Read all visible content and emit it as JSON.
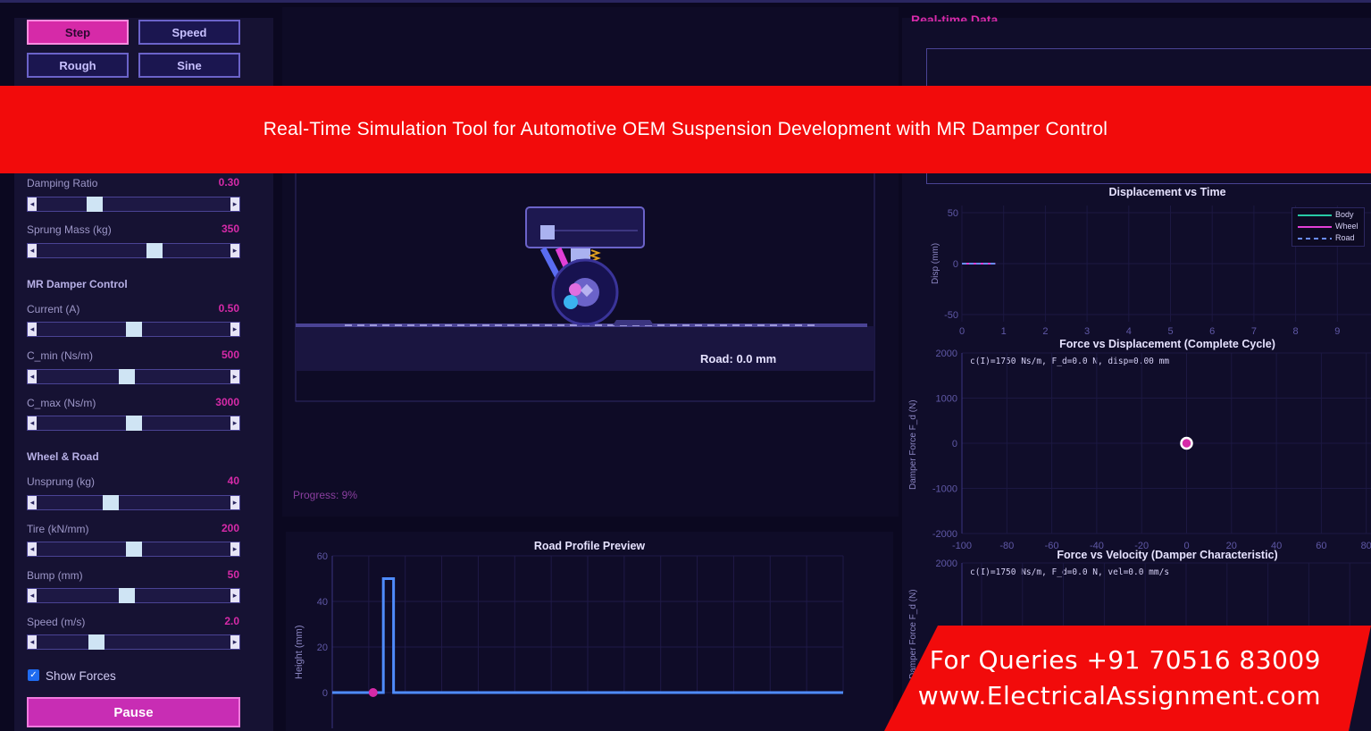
{
  "window": {
    "header_partial": "Real-time Data"
  },
  "modes": [
    {
      "label": "Step",
      "active": true
    },
    {
      "label": "Speed",
      "active": false
    },
    {
      "label": "Rough",
      "active": false
    },
    {
      "label": "Sine",
      "active": false
    }
  ],
  "params": {
    "damping": {
      "label": "Damping Ratio",
      "value": "0.30",
      "fraction": 0.28
    },
    "sprung": {
      "label": "Sprung Mass (kg)",
      "value": "350",
      "fraction": 0.62
    },
    "mr_section": "MR Damper Control",
    "current": {
      "label": "Current (A)",
      "value": "0.50",
      "fraction": 0.5
    },
    "cmin": {
      "label": "C_min (Ns/m)",
      "value": "500",
      "fraction": 0.46
    },
    "cmax": {
      "label": "C_max (Ns/m)",
      "value": "3000",
      "fraction": 0.5
    },
    "wheel_section": "Wheel & Road",
    "unsprung": {
      "label": "Unsprung (kg)",
      "value": "40",
      "fraction": 0.37
    },
    "tire": {
      "label": "Tire (kN/mm)",
      "value": "200",
      "fraction": 0.5
    },
    "bump": {
      "label": "Bump (mm)",
      "value": "50",
      "fraction": 0.46
    },
    "speed": {
      "label": "Speed (m/s)",
      "value": "2.0",
      "fraction": 0.29
    }
  },
  "show_forces": {
    "label": "Show Forces",
    "checked": true
  },
  "pause_label": "Pause",
  "banner": {
    "text": "Real-Time Simulation Tool for Automotive OEM Suspension Development with MR Damper Control"
  },
  "corner": {
    "queries": "For Queries +91 70516 83009",
    "website": "www.ElectricalAssignment.com"
  },
  "colors": {
    "accent": "#d62aa8",
    "banner": "#f20b0b",
    "body": "#27c9a6",
    "wheel": "#e23fd6",
    "road": "#6a8cff"
  },
  "animation": {
    "road_label": "Road: 0.0 mm"
  },
  "progress": {
    "label": "Progress: 9%",
    "percent": 9
  },
  "charts": [
    {
      "id": "road-profile",
      "title": "Road Profile Preview",
      "type": "line",
      "ylabel": "Height (mm)",
      "yticks": [
        "0",
        "20",
        "40",
        "60"
      ],
      "ylim": [
        0,
        60
      ],
      "series": [
        {
          "x": [
            0,
            0.1,
            0.1,
            0.12,
            0.12,
            1
          ],
          "y": [
            0,
            0,
            50,
            50,
            0,
            0
          ]
        }
      ],
      "marker": {
        "x": 0.08,
        "y": 0
      }
    },
    {
      "id": "disp-time",
      "title": "Displacement vs Time",
      "type": "line",
      "ylabel": "Disp (mm)",
      "xticks": [
        "0",
        "1",
        "2",
        "3",
        "4",
        "5",
        "6",
        "7",
        "8",
        "9"
      ],
      "yticks": [
        "50",
        "0",
        "-50"
      ],
      "ylim": [
        -50,
        50
      ],
      "xlim": [
        0,
        10
      ],
      "legend": [
        "Body",
        "Wheel",
        "Road"
      ],
      "legend_position": "top-right",
      "series": [
        {
          "name": "Body",
          "x": [
            0,
            0.8
          ],
          "y": [
            0,
            0
          ]
        },
        {
          "name": "Wheel",
          "x": [
            0,
            0.8
          ],
          "y": [
            0,
            0
          ]
        },
        {
          "name": "Road",
          "x": [
            0,
            0.8
          ],
          "y": [
            0,
            0
          ]
        }
      ]
    },
    {
      "id": "force-disp",
      "title": "Force vs Displacement (Complete Cycle)",
      "type": "scatter",
      "ylabel": "Damper Force F_d (N)",
      "annotation": "c(I)=1750 Ns/m, F_d=0.0 N, disp=0.00 mm",
      "xticks": [
        "-100",
        "-80",
        "-60",
        "-40",
        "-20",
        "0",
        "20",
        "40",
        "60",
        "80"
      ],
      "yticks": [
        "2000",
        "1000",
        "0",
        "-1000",
        "-2000"
      ],
      "xlim": [
        -100,
        100
      ],
      "ylim": [
        -2000,
        2000
      ],
      "point": {
        "x": 0,
        "y": 0
      }
    },
    {
      "id": "force-vel",
      "title": "Force vs Velocity (Damper Characteristic)",
      "type": "scatter",
      "ylabel": "Damper Force F_d (N)",
      "annotation": "c(I)=1750 Ns/m, F_d=0.0 N, vel=0.0 mm/s",
      "yticks": [
        "2000",
        "1000"
      ],
      "ylim": [
        -2000,
        2000
      ]
    }
  ]
}
